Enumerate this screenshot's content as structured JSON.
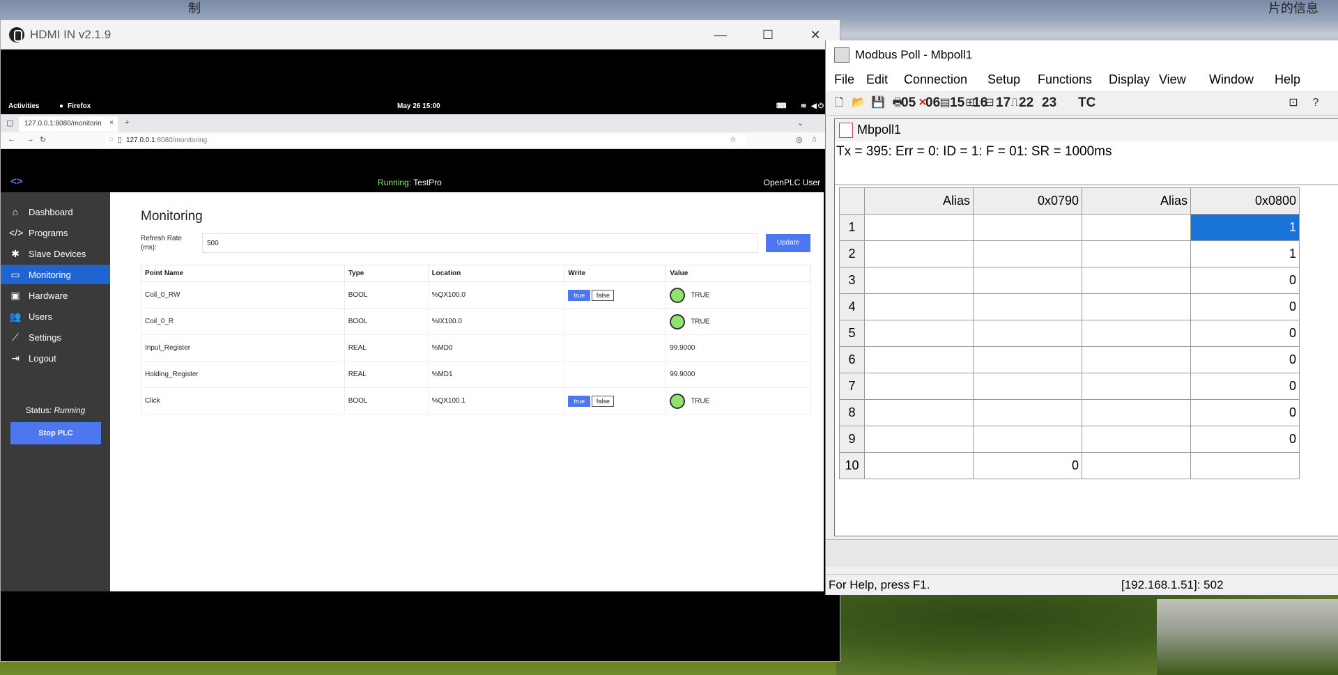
{
  "wallpaper": {
    "left_text": "制",
    "right_text": "片的信息"
  },
  "hdmi_window": {
    "title": "HDMI IN v2.1.9",
    "minimize": "—",
    "maximize": "☐",
    "close": "✕"
  },
  "ubuntu_bar": {
    "activities": "Activities",
    "app": "Firefox",
    "clock": "May 26 15:00"
  },
  "firefox": {
    "tab_title": "127.0.0.1:8080/monitorin",
    "tab_close": "×",
    "new_tab": "+",
    "url_host": "127.0.0.1",
    "url_rest": ":8080/monitoring"
  },
  "openplc": {
    "running_label": "Running:",
    "program_name": "TestPro",
    "user": "OpenPLC User",
    "sidebar": [
      {
        "label": "Dashboard",
        "icon": "home-icon",
        "glyph": "⌂"
      },
      {
        "label": "Programs",
        "icon": "code-icon",
        "glyph": "</>"
      },
      {
        "label": "Slave Devices",
        "icon": "gear-icon",
        "glyph": "✱"
      },
      {
        "label": "Monitoring",
        "icon": "monitor-icon",
        "glyph": "▭"
      },
      {
        "label": "Hardware",
        "icon": "chip-icon",
        "glyph": "▣"
      },
      {
        "label": "Users",
        "icon": "users-icon",
        "glyph": "👥"
      },
      {
        "label": "Settings",
        "icon": "wrench-icon",
        "glyph": "⟋"
      },
      {
        "label": "Logout",
        "icon": "logout-icon",
        "glyph": "⇥"
      }
    ],
    "status_label": "Status:",
    "status_value": "Running",
    "stop_button": "Stop PLC",
    "page_title": "Monitoring",
    "refresh_label": "Refresh Rate (ms):",
    "refresh_value": "500",
    "update_button": "Update",
    "columns": [
      "Point Name",
      "Type",
      "Location",
      "Write",
      "Value"
    ],
    "rows": [
      {
        "name": "Coil_0_RW",
        "type": "BOOL",
        "location": "%QX100.0",
        "writable": true,
        "value": "TRUE",
        "led": true
      },
      {
        "name": "Coil_0_R",
        "type": "BOOL",
        "location": "%IX100.0",
        "writable": false,
        "value": "TRUE",
        "led": true
      },
      {
        "name": "Input_Register",
        "type": "REAL",
        "location": "%MD0",
        "writable": false,
        "value": "99.9000",
        "led": false
      },
      {
        "name": "Holding_Register",
        "type": "REAL",
        "location": "%MD1",
        "writable": false,
        "value": "99.9000",
        "led": false
      },
      {
        "name": "Click",
        "type": "BOOL",
        "location": "%QX100.1",
        "writable": true,
        "value": "TRUE",
        "led": true
      }
    ],
    "write_true": "true",
    "write_false": "false"
  },
  "modbus": {
    "title": "Modbus Poll - Mbpoll1",
    "menu": [
      "File",
      "Edit",
      "Connection",
      "Setup",
      "Functions",
      "Display",
      "View",
      "Window",
      "Help"
    ],
    "function_codes": [
      "05",
      "06",
      "15",
      "16",
      "17",
      "22",
      "23",
      "TC"
    ],
    "child_title": "Mbpoll1",
    "status_text": "Tx = 395: Err = 0: ID = 1: F = 01: SR = 1000ms",
    "grid_headers": [
      "Alias",
      "0x0790",
      "Alias",
      "0x0800"
    ],
    "grid_rows": [
      [
        "1",
        "",
        "",
        "",
        "1"
      ],
      [
        "2",
        "",
        "",
        "",
        "1"
      ],
      [
        "3",
        "",
        "",
        "",
        "0"
      ],
      [
        "4",
        "",
        "",
        "",
        "0"
      ],
      [
        "5",
        "",
        "",
        "",
        "0"
      ],
      [
        "6",
        "",
        "",
        "",
        "0"
      ],
      [
        "7",
        "",
        "",
        "",
        "0"
      ],
      [
        "8",
        "",
        "",
        "",
        "0"
      ],
      [
        "9",
        "",
        "",
        "",
        "0"
      ],
      [
        "10",
        "",
        "0",
        "",
        ""
      ]
    ],
    "statusbar_help": "For Help, press F1.",
    "statusbar_conn": "[192.168.1.51]: 502"
  }
}
